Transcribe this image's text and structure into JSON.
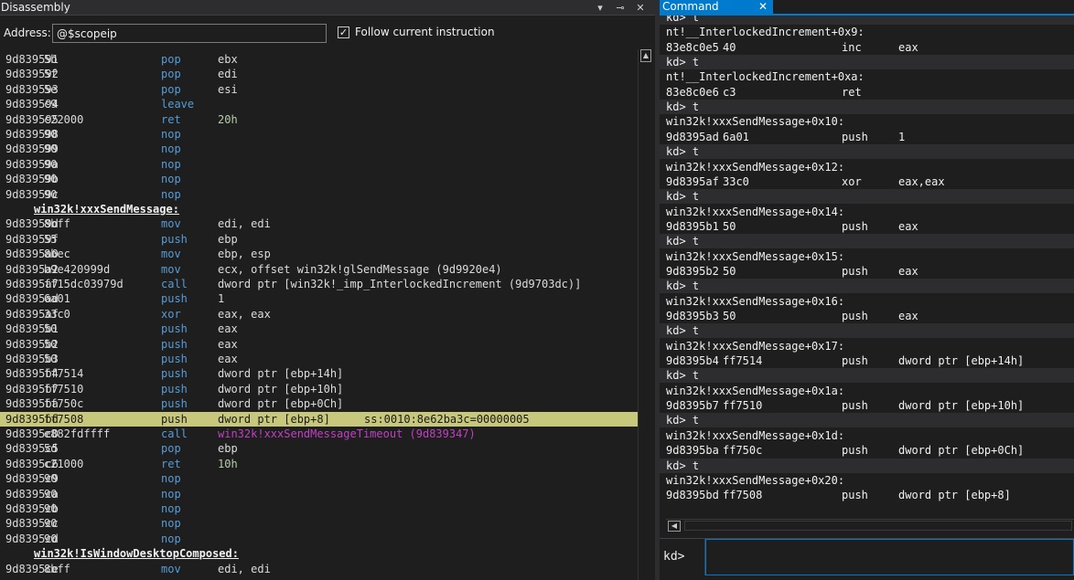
{
  "disassembly": {
    "title": "Disassembly",
    "dropdown_glyph": "▾",
    "pin_glyph": "⊸",
    "close_glyph": "✕",
    "address_label": "Address:",
    "address_value": "@$scopeip",
    "follow_checked": true,
    "follow_label": "Follow current instruction",
    "rows": [
      {
        "kind": "insn",
        "addr": "9d839591",
        "bytes": "5b",
        "mnemonic": "pop",
        "operands": "ebx"
      },
      {
        "kind": "insn",
        "addr": "9d839592",
        "bytes": "5f",
        "mnemonic": "pop",
        "operands": "edi"
      },
      {
        "kind": "insn",
        "addr": "9d839593",
        "bytes": "5e",
        "mnemonic": "pop",
        "operands": "esi"
      },
      {
        "kind": "insn",
        "addr": "9d839594",
        "bytes": "c9",
        "mnemonic": "leave",
        "operands": ""
      },
      {
        "kind": "insn",
        "addr": "9d839595",
        "bytes": "c22000",
        "mnemonic": "ret",
        "operands": "20h",
        "numeric": true
      },
      {
        "kind": "insn",
        "addr": "9d839598",
        "bytes": "90",
        "mnemonic": "nop",
        "operands": ""
      },
      {
        "kind": "insn",
        "addr": "9d839599",
        "bytes": "90",
        "mnemonic": "nop",
        "operands": ""
      },
      {
        "kind": "insn",
        "addr": "9d83959a",
        "bytes": "90",
        "mnemonic": "nop",
        "operands": ""
      },
      {
        "kind": "insn",
        "addr": "9d83959b",
        "bytes": "90",
        "mnemonic": "nop",
        "operands": ""
      },
      {
        "kind": "insn",
        "addr": "9d83959c",
        "bytes": "90",
        "mnemonic": "nop",
        "operands": ""
      },
      {
        "kind": "label",
        "text": "win32k!xxxSendMessage:"
      },
      {
        "kind": "insn",
        "addr": "9d83959d",
        "bytes": "8bff",
        "mnemonic": "mov",
        "operands": "edi, edi"
      },
      {
        "kind": "insn",
        "addr": "9d83959f",
        "bytes": "55",
        "mnemonic": "push",
        "operands": "ebp"
      },
      {
        "kind": "insn",
        "addr": "9d8395a0",
        "bytes": "8bec",
        "mnemonic": "mov",
        "operands": "ebp, esp"
      },
      {
        "kind": "insn",
        "addr": "9d8395a2",
        "bytes": "b9e420999d",
        "mnemonic": "mov",
        "operands": "ecx, offset win32k!glSendMessage (9d9920e4)"
      },
      {
        "kind": "insn",
        "addr": "9d8395a7",
        "bytes": "ff15dc03979d",
        "mnemonic": "call",
        "operands": "dword ptr [win32k!_imp_InterlockedIncrement (9d9703dc)]"
      },
      {
        "kind": "insn",
        "addr": "9d8395ad",
        "bytes": "6a01",
        "mnemonic": "push",
        "operands": "1"
      },
      {
        "kind": "insn",
        "addr": "9d8395af",
        "bytes": "33c0",
        "mnemonic": "xor",
        "operands": "eax, eax"
      },
      {
        "kind": "insn",
        "addr": "9d8395b1",
        "bytes": "50",
        "mnemonic": "push",
        "operands": "eax"
      },
      {
        "kind": "insn",
        "addr": "9d8395b2",
        "bytes": "50",
        "mnemonic": "push",
        "operands": "eax"
      },
      {
        "kind": "insn",
        "addr": "9d8395b3",
        "bytes": "50",
        "mnemonic": "push",
        "operands": "eax"
      },
      {
        "kind": "insn",
        "addr": "9d8395b4",
        "bytes": "ff7514",
        "mnemonic": "push",
        "operands": "dword ptr [ebp+14h]"
      },
      {
        "kind": "insn",
        "addr": "9d8395b7",
        "bytes": "ff7510",
        "mnemonic": "push",
        "operands": "dword ptr [ebp+10h]"
      },
      {
        "kind": "insn",
        "addr": "9d8395ba",
        "bytes": "ff750c",
        "mnemonic": "push",
        "operands": "dword ptr [ebp+0Ch]"
      },
      {
        "kind": "insn",
        "addr": "9d8395bd",
        "bytes": "ff7508",
        "mnemonic": "push",
        "operands": "dword ptr [ebp+8]",
        "extra": "ss:0010:8e62ba3c=00000005",
        "current": true
      },
      {
        "kind": "insn",
        "addr": "9d8395c0",
        "bytes": "e882fdffff",
        "mnemonic": "call",
        "operands": "win32k!xxxSendMessageTimeout (9d839347)",
        "target": true
      },
      {
        "kind": "insn",
        "addr": "9d8395c5",
        "bytes": "5d",
        "mnemonic": "pop",
        "operands": "ebp"
      },
      {
        "kind": "insn",
        "addr": "9d8395c6",
        "bytes": "c21000",
        "mnemonic": "ret",
        "operands": "10h",
        "numeric": true
      },
      {
        "kind": "insn",
        "addr": "9d8395c9",
        "bytes": "90",
        "mnemonic": "nop",
        "operands": ""
      },
      {
        "kind": "insn",
        "addr": "9d8395ca",
        "bytes": "90",
        "mnemonic": "nop",
        "operands": ""
      },
      {
        "kind": "insn",
        "addr": "9d8395cb",
        "bytes": "90",
        "mnemonic": "nop",
        "operands": ""
      },
      {
        "kind": "insn",
        "addr": "9d8395cc",
        "bytes": "90",
        "mnemonic": "nop",
        "operands": ""
      },
      {
        "kind": "insn",
        "addr": "9d8395cd",
        "bytes": "90",
        "mnemonic": "nop",
        "operands": ""
      },
      {
        "kind": "label",
        "text": "win32k!IsWindowDesktopComposed:"
      },
      {
        "kind": "insn",
        "addr": "9d8395ce",
        "bytes": "8bff",
        "mnemonic": "mov",
        "operands": "edi, edi"
      }
    ]
  },
  "command": {
    "tab_label": "Command",
    "close_glyph": "✕",
    "prompt": "kd>",
    "input_value": "",
    "lines": [
      {
        "kind": "prompt",
        "text": "kd> t"
      },
      {
        "kind": "text",
        "text": "nt!__InterlockedIncrement+0x9:"
      },
      {
        "kind": "insn",
        "addr": "83e8c0e5",
        "bytes": "40",
        "mnemonic": "inc",
        "operands": "eax"
      },
      {
        "kind": "prompt",
        "text": "kd> t"
      },
      {
        "kind": "text",
        "text": "nt!__InterlockedIncrement+0xa:"
      },
      {
        "kind": "insn",
        "addr": "83e8c0e6",
        "bytes": "c3",
        "mnemonic": "ret",
        "operands": ""
      },
      {
        "kind": "prompt",
        "text": "kd> t"
      },
      {
        "kind": "text",
        "text": "win32k!xxxSendMessage+0x10:"
      },
      {
        "kind": "insn",
        "addr": "9d8395ad",
        "bytes": "6a01",
        "mnemonic": "push",
        "operands": "1"
      },
      {
        "kind": "prompt",
        "text": "kd> t"
      },
      {
        "kind": "text",
        "text": "win32k!xxxSendMessage+0x12:"
      },
      {
        "kind": "insn",
        "addr": "9d8395af",
        "bytes": "33c0",
        "mnemonic": "xor",
        "operands": "eax,eax"
      },
      {
        "kind": "prompt",
        "text": "kd> t"
      },
      {
        "kind": "text",
        "text": "win32k!xxxSendMessage+0x14:"
      },
      {
        "kind": "insn",
        "addr": "9d8395b1",
        "bytes": "50",
        "mnemonic": "push",
        "operands": "eax"
      },
      {
        "kind": "prompt",
        "text": "kd> t"
      },
      {
        "kind": "text",
        "text": "win32k!xxxSendMessage+0x15:"
      },
      {
        "kind": "insn",
        "addr": "9d8395b2",
        "bytes": "50",
        "mnemonic": "push",
        "operands": "eax"
      },
      {
        "kind": "prompt",
        "text": "kd> t"
      },
      {
        "kind": "text",
        "text": "win32k!xxxSendMessage+0x16:"
      },
      {
        "kind": "insn",
        "addr": "9d8395b3",
        "bytes": "50",
        "mnemonic": "push",
        "operands": "eax"
      },
      {
        "kind": "prompt",
        "text": "kd> t"
      },
      {
        "kind": "text",
        "text": "win32k!xxxSendMessage+0x17:"
      },
      {
        "kind": "insn",
        "addr": "9d8395b4",
        "bytes": "ff7514",
        "mnemonic": "push",
        "operands": "dword ptr [ebp+14h]"
      },
      {
        "kind": "prompt",
        "text": "kd> t"
      },
      {
        "kind": "text",
        "text": "win32k!xxxSendMessage+0x1a:"
      },
      {
        "kind": "insn",
        "addr": "9d8395b7",
        "bytes": "ff7510",
        "mnemonic": "push",
        "operands": "dword ptr [ebp+10h]"
      },
      {
        "kind": "prompt",
        "text": "kd> t"
      },
      {
        "kind": "text",
        "text": "win32k!xxxSendMessage+0x1d:"
      },
      {
        "kind": "insn",
        "addr": "9d8395ba",
        "bytes": "ff750c",
        "mnemonic": "push",
        "operands": "dword ptr [ebp+0Ch]"
      },
      {
        "kind": "prompt",
        "text": "kd> t"
      },
      {
        "kind": "text",
        "text": "win32k!xxxSendMessage+0x20:"
      },
      {
        "kind": "insn",
        "addr": "9d8395bd",
        "bytes": "ff7508",
        "mnemonic": "push",
        "operands": "dword ptr [ebp+8]"
      }
    ]
  },
  "colors": {
    "background": "#1e1e1e",
    "accent": "#007acc",
    "current_line": "#c8c87c",
    "mnemonic": "#569cd6",
    "numeric": "#b5cea8",
    "call_target": "#c040c0"
  }
}
